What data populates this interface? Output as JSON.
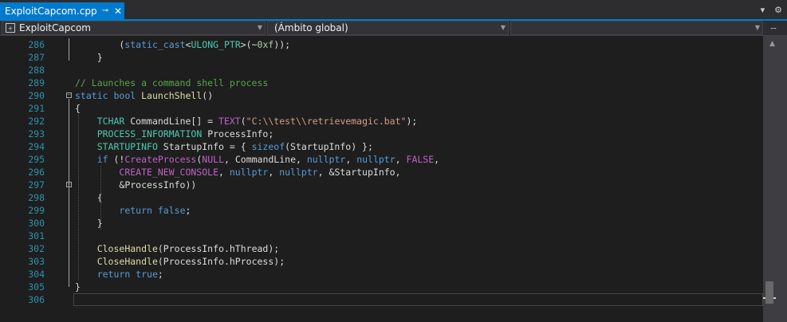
{
  "tab": {
    "title": "ExploitCapcom.cpp",
    "pin_glyph": "⊸",
    "close_glyph": "✕"
  },
  "toolbar_right": {
    "dropdown_glyph": "▾",
    "gear_glyph": "⚙"
  },
  "navbar": {
    "project": "ExploitCapcom",
    "scope": "(Ámbito global)",
    "member": "",
    "split_glyph": "⧿"
  },
  "colors": {
    "accent": "#007acc",
    "keyword": "#569cd6",
    "type": "#4ec9b0",
    "function": "#dcdcaa",
    "string": "#d69d85",
    "comment": "#57a64a",
    "macro": "#bd63c5",
    "line_number": "#2b91af"
  },
  "editor": {
    "lines": [
      {
        "n": "286",
        "tokens": [
          [
            "        ",
            ""
          ],
          [
            "(",
            "id"
          ],
          [
            "static_cast",
            "kw"
          ],
          [
            "<",
            "id"
          ],
          [
            "ULONG_PTR",
            "ty"
          ],
          [
            ">(~",
            "id"
          ],
          [
            "0xf",
            "nu"
          ],
          [
            "));",
            "id"
          ]
        ]
      },
      {
        "n": "287",
        "tokens": [
          [
            "    }",
            "id"
          ]
        ]
      },
      {
        "n": "288",
        "tokens": []
      },
      {
        "n": "289",
        "tokens": [
          [
            "// Launches a command shell process",
            "cm"
          ]
        ]
      },
      {
        "n": "290",
        "tokens": [
          [
            "static",
            "kw"
          ],
          [
            " ",
            ""
          ],
          [
            "bool",
            "kw"
          ],
          [
            " ",
            ""
          ],
          [
            "LaunchShell",
            "fn"
          ],
          [
            "()",
            "id"
          ]
        ]
      },
      {
        "n": "291",
        "tokens": [
          [
            "{",
            "id"
          ]
        ]
      },
      {
        "n": "292",
        "tokens": [
          [
            "    ",
            ""
          ],
          [
            "TCHAR",
            "ty"
          ],
          [
            " CommandLine[] = ",
            "id"
          ],
          [
            "TEXT",
            "mc"
          ],
          [
            "(",
            "id"
          ],
          [
            "\"C:\\\\test\\\\retrievemagic.bat\"",
            "st"
          ],
          [
            ");",
            "id"
          ]
        ]
      },
      {
        "n": "293",
        "tokens": [
          [
            "    ",
            ""
          ],
          [
            "PROCESS_INFORMATION",
            "ty"
          ],
          [
            " ProcessInfo;",
            "id"
          ]
        ]
      },
      {
        "n": "294",
        "tokens": [
          [
            "    ",
            ""
          ],
          [
            "STARTUPINFO",
            "ty"
          ],
          [
            " StartupInfo = { ",
            "id"
          ],
          [
            "sizeof",
            "kw"
          ],
          [
            "(StartupInfo) };",
            "id"
          ]
        ]
      },
      {
        "n": "295",
        "tokens": [
          [
            "    ",
            ""
          ],
          [
            "if",
            "kw"
          ],
          [
            " (!",
            "id"
          ],
          [
            "CreateProcess",
            "mc"
          ],
          [
            "(",
            "id"
          ],
          [
            "NULL",
            "mc"
          ],
          [
            ", CommandLine, ",
            "id"
          ],
          [
            "nullptr",
            "kw"
          ],
          [
            ", ",
            "id"
          ],
          [
            "nullptr",
            "kw"
          ],
          [
            ", ",
            "id"
          ],
          [
            "FALSE",
            "mc"
          ],
          [
            ",",
            "id"
          ]
        ]
      },
      {
        "n": "296",
        "tokens": [
          [
            "        ",
            ""
          ],
          [
            "CREATE_NEW_CONSOLE",
            "mc"
          ],
          [
            ", ",
            "id"
          ],
          [
            "nullptr",
            "kw"
          ],
          [
            ", ",
            "id"
          ],
          [
            "nullptr",
            "kw"
          ],
          [
            ", &StartupInfo,",
            "id"
          ]
        ]
      },
      {
        "n": "297",
        "tokens": [
          [
            "        ",
            ""
          ],
          [
            "&ProcessInfo))",
            "id"
          ]
        ]
      },
      {
        "n": "298",
        "tokens": [
          [
            "    {",
            "id"
          ]
        ]
      },
      {
        "n": "299",
        "tokens": [
          [
            "        ",
            ""
          ],
          [
            "return",
            "kw"
          ],
          [
            " ",
            ""
          ],
          [
            "false",
            "kw"
          ],
          [
            ";",
            "id"
          ]
        ]
      },
      {
        "n": "300",
        "tokens": [
          [
            "    }",
            "id"
          ]
        ]
      },
      {
        "n": "301",
        "tokens": []
      },
      {
        "n": "302",
        "tokens": [
          [
            "    ",
            ""
          ],
          [
            "CloseHandle",
            "fn"
          ],
          [
            "(ProcessInfo.hThread);",
            "id"
          ]
        ]
      },
      {
        "n": "303",
        "tokens": [
          [
            "    ",
            ""
          ],
          [
            "CloseHandle",
            "fn"
          ],
          [
            "(ProcessInfo.hProcess);",
            "id"
          ]
        ]
      },
      {
        "n": "304",
        "tokens": [
          [
            "    ",
            ""
          ],
          [
            "return",
            "kw"
          ],
          [
            " ",
            ""
          ],
          [
            "true",
            "kw"
          ],
          [
            ";",
            "id"
          ]
        ]
      },
      {
        "n": "305",
        "tokens": [
          [
            "}",
            "id"
          ]
        ]
      },
      {
        "n": "306",
        "tokens": []
      }
    ],
    "fold_lines": [
      "290",
      "297"
    ],
    "current_line": "306"
  }
}
